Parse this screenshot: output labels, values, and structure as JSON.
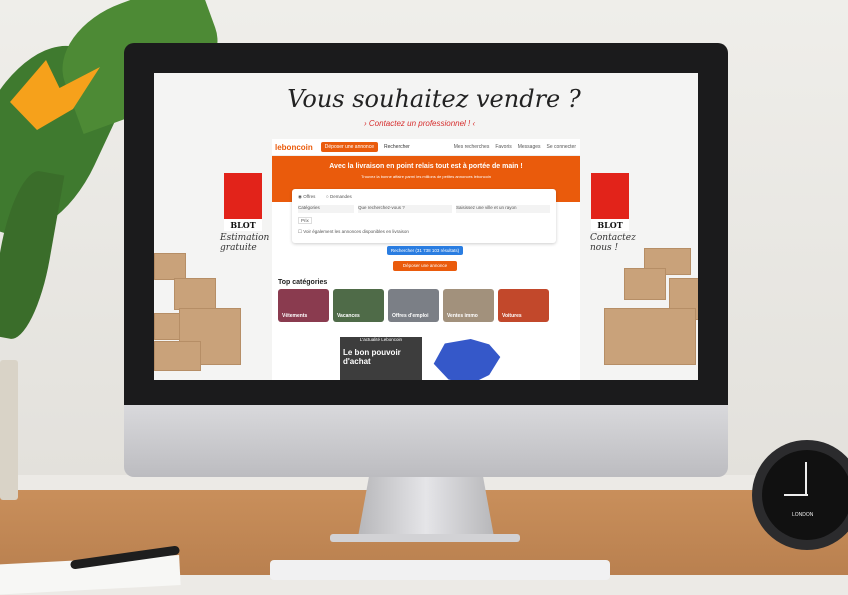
{
  "scene": {
    "clock_label": "LONDON",
    "apple_glyph": ""
  },
  "banner": {
    "headline": "Vous souhaitez vendre ?",
    "subline": "› Contactez un professionnel ! ‹",
    "brand_left": "BLOT",
    "brand_right": "BLOT",
    "note_left": "Estimation gratuite",
    "note_right": "Contactez nous !"
  },
  "site": {
    "logo": "leboncoin",
    "post_ad": "Déposer une annonce",
    "search": "Rechercher",
    "nav_icons": [
      "Mes recherches",
      "Favoris",
      "Messages",
      "Se connecter"
    ],
    "hero_title": "Avec la livraison en point relais tout est à portée de main !",
    "hero_sub": "Trouvez la bonne affaire parmi les millions de petites annonces leboncoin",
    "radio_offers": "Offres",
    "radio_demands": "Demandes",
    "category_select": "Catégories",
    "query_placeholder": "Que recherchez-vous ?",
    "location_placeholder": "Saisissez une ville et un rayon",
    "price_chip": "Prix",
    "checkbox_label": "Voir également les annonces disponibles en livraison",
    "search_button": "Rechercher (31 738 103 résultats)",
    "post_button": "Déposer une annonce",
    "top_categories": "Top catégories",
    "categories": [
      "Vêtements",
      "Vacances",
      "Offres d'emploi",
      "Ventes immo",
      "Voitures"
    ],
    "news_title": "L'actualité Leboncoin",
    "news_headline": "Le bon pouvoir d'achat"
  }
}
